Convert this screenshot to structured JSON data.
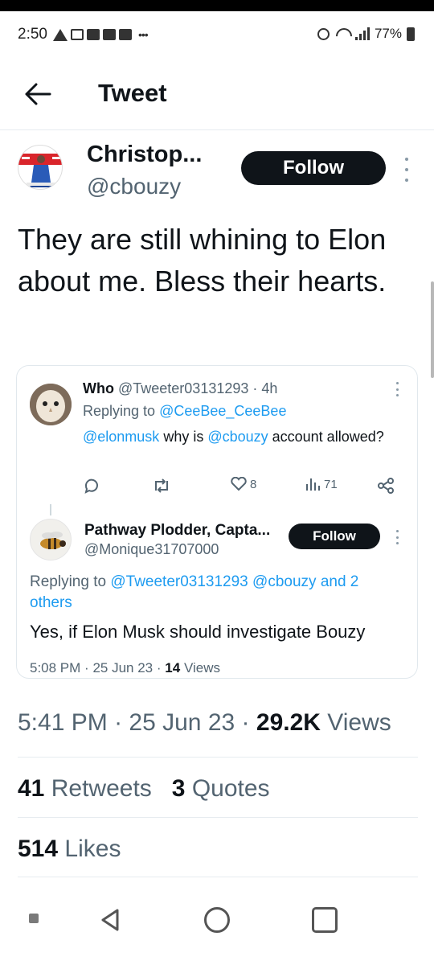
{
  "status_bar": {
    "time": "2:50",
    "battery": "77%",
    "dots": "•••"
  },
  "header": {
    "title": "Tweet"
  },
  "tweet": {
    "author_name": "Christop...",
    "author_handle": "@cbouzy",
    "follow_label": "Follow",
    "text": "They are still whining to Elon about me. Bless their hearts.",
    "time": "5:41 PM",
    "date": "25 Jun 23",
    "views_count": "29.2K",
    "views_label": "Views",
    "retweets_count": "41",
    "retweets_label": "Retweets",
    "quotes_count": "3",
    "quotes_label": "Quotes",
    "likes_count": "514",
    "likes_label": "Likes"
  },
  "quoted_tweet": {
    "author_name": "Who",
    "author_handle": "@Tweeter03131293",
    "age": "4h",
    "replying_prefix": "Replying to",
    "replying_handle": "@CeeBee_CeeBee",
    "mention1": "@elonmusk",
    "text_mid": " why is ",
    "mention2": "@cbouzy",
    "text_end": " account allowed?",
    "likes": "8",
    "views": "71"
  },
  "reply_tweet": {
    "author_name": "Pathway Plodder, Capta...",
    "author_handle": "@Monique31707000",
    "follow_label": "Follow",
    "replying_prefix": "Replying to",
    "replying_handle1": "@Tweeter03131293",
    "replying_handle2": "@cbouzy",
    "replying_suffix": "and 2 others",
    "text": "Yes, if Elon Musk should investigate Bouzy",
    "time": "5:08 PM",
    "date": "25 Jun 23",
    "views_count": "14",
    "views_label": "Views"
  }
}
